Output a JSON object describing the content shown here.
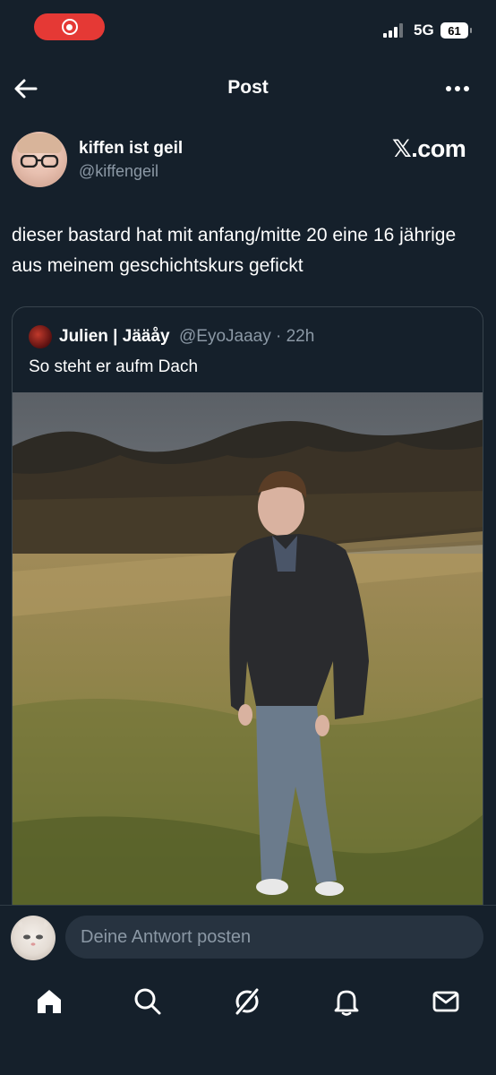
{
  "status_bar": {
    "network": "5G",
    "battery": "61",
    "icons": [
      "screen-record-icon",
      "signal-icon",
      "battery-icon"
    ]
  },
  "header": {
    "title": "Post",
    "icons": [
      "back-arrow-icon",
      "more-icon"
    ]
  },
  "tweet": {
    "display_name": "kiffen ist geil",
    "handle": "@kiffengeil",
    "source_brand": "𝕏.com",
    "text": "dieser bastard hat mit anfang/mitte 20 eine 16 jährige aus meinem geschichtskurs gefickt"
  },
  "quoted_tweet": {
    "display_name": "Julien | Jääåy",
    "meta": "@EyoJaaay · 22h",
    "text": "So steht er aufm Dach"
  },
  "reply": {
    "placeholder": "Deine Antwort posten"
  },
  "bottom_nav": {
    "icons": [
      "home-icon",
      "search-icon",
      "grok-icon",
      "notifications-icon",
      "messages-icon"
    ]
  },
  "colors": {
    "background": "#15202b",
    "text_primary": "#e7e9ea",
    "text_secondary": "#8b98a5",
    "border": "#38444d",
    "record_pill": "#e53935"
  }
}
